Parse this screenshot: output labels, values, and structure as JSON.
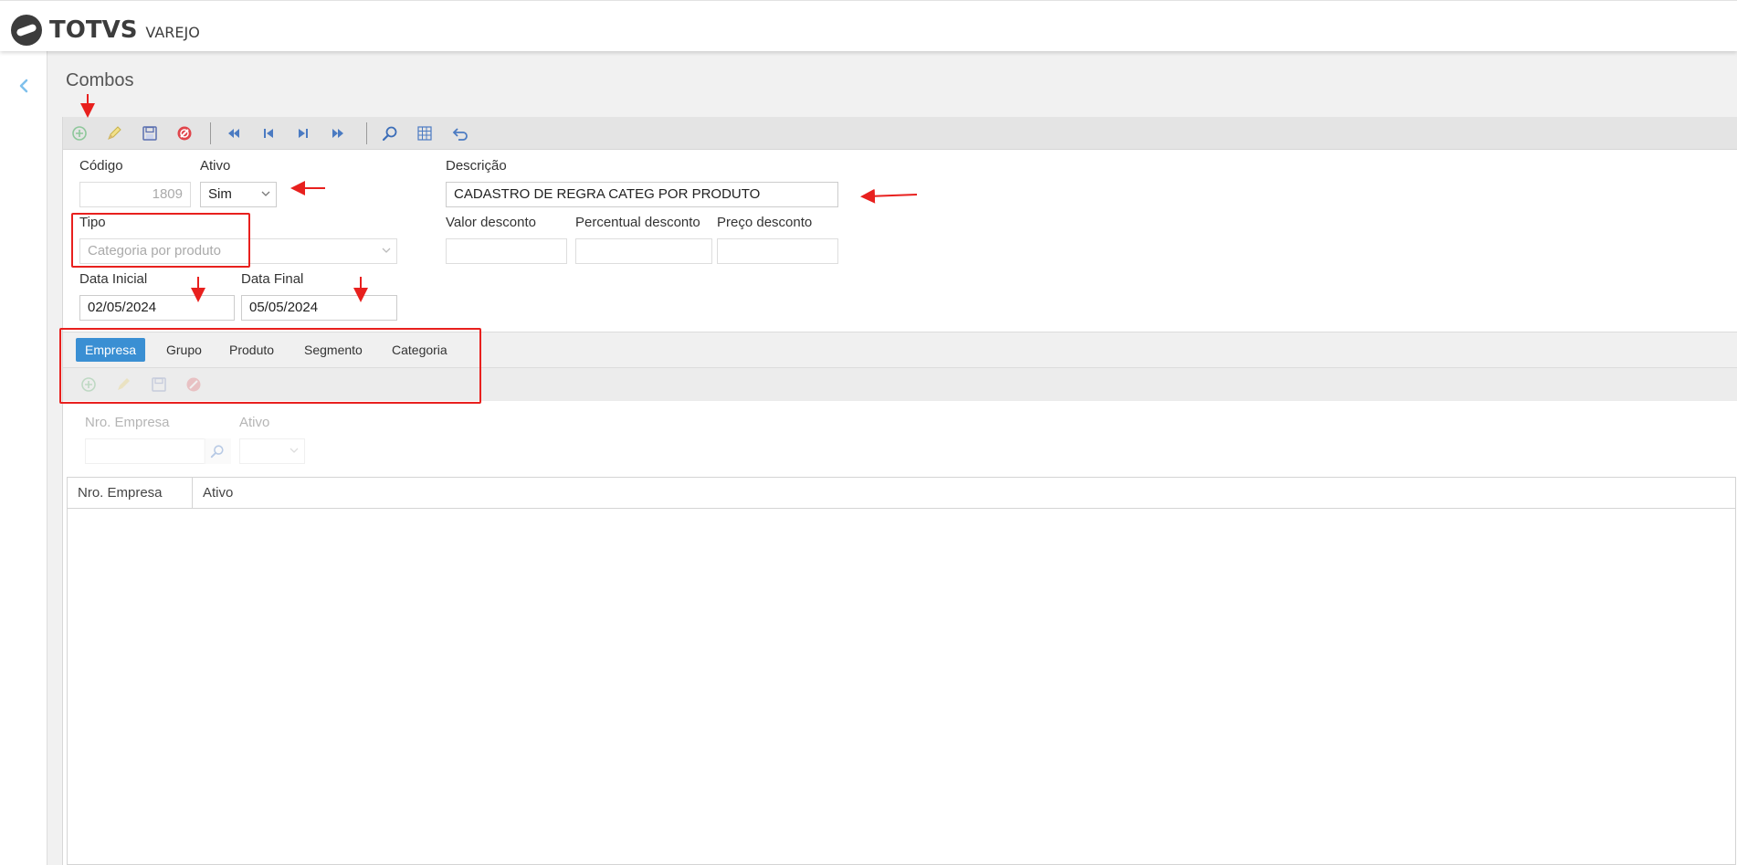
{
  "app": {
    "brand": "TOTVS",
    "subbrand": "VAREJO",
    "page_title": "Combos"
  },
  "toolbar": {
    "buttons": [
      "add-icon",
      "edit-icon",
      "save-icon",
      "cancel-icon",
      "first-record-icon",
      "previous-record-icon",
      "next-record-icon",
      "last-record-icon",
      "search-icon",
      "grid-icon",
      "undo-icon"
    ]
  },
  "form": {
    "codigo_label": "Código",
    "codigo_value": "1809",
    "ativo_label": "Ativo",
    "ativo_value": "Sim",
    "descricao_label": "Descrição",
    "descricao_value": "CADASTRO DE REGRA CATEG POR PRODUTO",
    "tipo_label": "Tipo",
    "tipo_value": "Categoria por produto",
    "valor_desconto_label": "Valor desconto",
    "percentual_desconto_label": "Percentual desconto",
    "preco_desconto_label": "Preço desconto",
    "data_inicial_label": "Data Inicial",
    "data_inicial_value": "02/05/2024",
    "data_final_label": "Data Final",
    "data_final_value": "05/05/2024"
  },
  "tabs": [
    {
      "label": "Empresa",
      "active": true
    },
    {
      "label": "Grupo",
      "active": false
    },
    {
      "label": "Produto",
      "active": false
    },
    {
      "label": "Segmento",
      "active": false
    },
    {
      "label": "Categoria",
      "active": false
    }
  ],
  "detail": {
    "nro_empresa_label": "Nro. Empresa",
    "ativo_label": "Ativo"
  },
  "grid": {
    "columns": [
      "Nro. Empresa",
      "Ativo"
    ],
    "rows": []
  },
  "colors": {
    "accent": "#3a8fd3",
    "annotation": "#e8201e",
    "toolbar_bg": "#e4e4e4"
  }
}
